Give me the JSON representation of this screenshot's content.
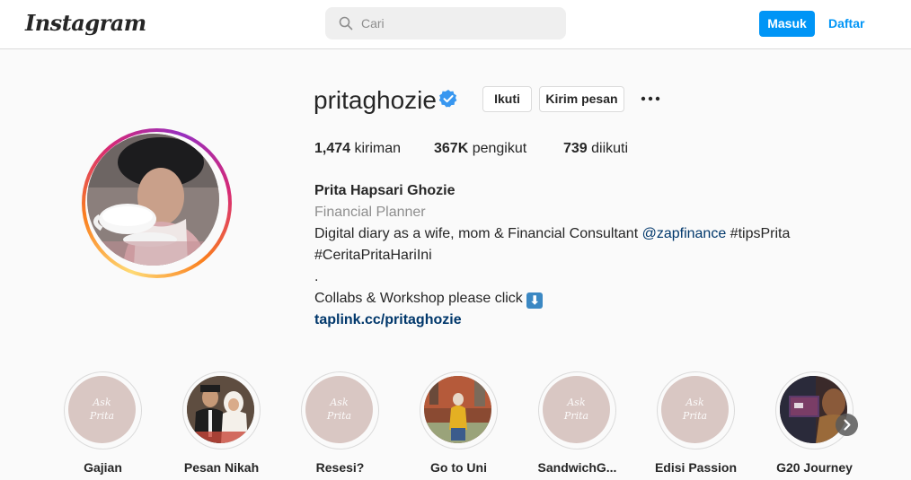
{
  "nav": {
    "logo": "Instagram",
    "search_placeholder": "Cari",
    "login_label": "Masuk",
    "signup_label": "Daftar",
    "accent_color": "#0095f6"
  },
  "profile": {
    "username": "pritaghozie",
    "verified_icon": "verified-badge-icon",
    "follow_label": "Ikuti",
    "message_label": "Kirim pesan",
    "more_icon": "more-options-icon",
    "stats": [
      {
        "value": "1,474",
        "label": " kiriman"
      },
      {
        "value": "367K",
        "label": " pengikut"
      },
      {
        "value": "739",
        "label": " diikuti"
      }
    ],
    "bio": {
      "full_name": "Prita Hapsari Ghozie",
      "category": "Financial Planner",
      "line1_pre": "Digital diary as a wife, mom & Financial Consultant ",
      "line1_mention": "@zapfinance",
      "line1_post": " #tipsPrita",
      "line2": "#CeritaPritaHariIni",
      "line3": ".",
      "line4": "Collabs & Workshop please click ",
      "line4_emoji": "⬇",
      "link": "taplink.cc/pritaghozie"
    }
  },
  "highlights": [
    {
      "label": "Gajian",
      "cover_text_1": "Ask",
      "cover_text_2": "Prita"
    },
    {
      "label": "Pesan Nikah"
    },
    {
      "label": "Resesi?",
      "cover_text_1": "Ask",
      "cover_text_2": "Prita"
    },
    {
      "label": "Go to Uni"
    },
    {
      "label": "SandwichG...",
      "cover_text_1": "Ask",
      "cover_text_2": "Prita"
    },
    {
      "label": "Edisi Passion",
      "cover_text_1": "Ask",
      "cover_text_2": "Prita"
    },
    {
      "label": "G20 Journey"
    }
  ],
  "highlights_next_icon": "chevron-right-icon"
}
